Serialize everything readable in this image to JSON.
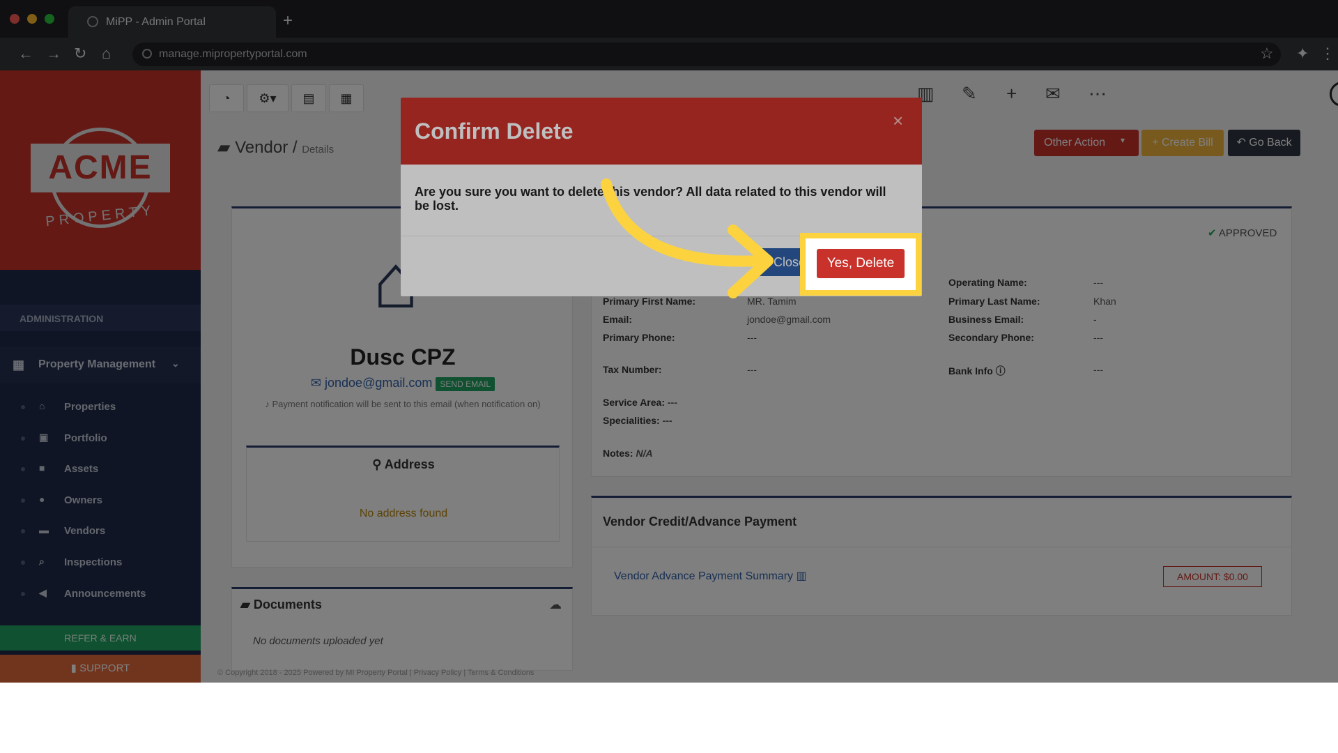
{
  "browser": {
    "tab_title": "MiPP - Admin Portal",
    "url": "manage.mipropertyportal.com",
    "new_tab_glyph": "+"
  },
  "logo": {
    "main": "ACME",
    "sub": "PROPERTY"
  },
  "sidebar": {
    "section": "ADMINISTRATION",
    "group": "Property Management",
    "items": [
      {
        "label": "Properties",
        "icon": "home-icon"
      },
      {
        "label": "Portfolio",
        "icon": "portfolio-icon"
      },
      {
        "label": "Assets",
        "icon": "assets-icon"
      },
      {
        "label": "Owners",
        "icon": "user-icon"
      },
      {
        "label": "Vendors",
        "icon": "briefcase-icon"
      },
      {
        "label": "Inspections",
        "icon": "search-icon"
      },
      {
        "label": "Announcements",
        "icon": "megaphone-icon"
      }
    ],
    "refer": "REFER & EARN",
    "support": "SUPPORT"
  },
  "page": {
    "title": "Vendor",
    "separator": "/",
    "subtitle": "Details",
    "buttons": {
      "other": "Other Action",
      "bill": "Create Bill",
      "back": "Go Back"
    }
  },
  "vendor": {
    "name": "Dusc CPZ",
    "email": "jondoe@gmail.com",
    "send_email": "SEND EMAIL",
    "notice": "Payment notification will be sent to this email (when notification on)",
    "address_title": "Address",
    "no_address": "No address found",
    "documents_title": "Documents",
    "no_documents": "No documents uploaded yet",
    "status": "APPROVED",
    "fields": {
      "operating_name_label": "Operating Name:",
      "operating_name": "---",
      "primary_first_label": "Primary First Name:",
      "primary_first": "MR. Tamim",
      "primary_last_label": "Primary Last Name:",
      "primary_last": "Khan",
      "email_label": "Email:",
      "email": "jondoe@gmail.com",
      "business_email_label": "Business Email:",
      "business_email": "-",
      "primary_phone_label": "Primary Phone:",
      "primary_phone": "---",
      "secondary_phone_label": "Secondary Phone:",
      "secondary_phone": "---",
      "tax_label": "Tax Number:",
      "tax": "---",
      "bank_label": "Bank Info",
      "bank": "---",
      "service_area_label": "Service Area:",
      "service_area": "---",
      "specialities_label": "Specialities:",
      "specialities": "---",
      "notes_label": "Notes:",
      "notes": "N/A"
    },
    "credit_title": "Vendor Credit/Advance Payment",
    "advance_link": "Vendor Advance Payment Summary",
    "amount": "AMOUNT: $0.00"
  },
  "footer_text": "© Copyright 2018 - 2025 Powered by MI Property Portal | Privacy Policy | Terms & Conditions",
  "modal": {
    "title": "Confirm Delete",
    "body": "Are you sure you want to delete this vendor? All data related to this vendor will be lost.",
    "close": "Close",
    "confirm": "Yes, Delete",
    "close_glyph": "×"
  },
  "colors": {
    "primary_red": "#c8322b",
    "highlight": "#fcd33f",
    "sidebar": "#1e2a4a",
    "arrow": "#fcd33f"
  }
}
